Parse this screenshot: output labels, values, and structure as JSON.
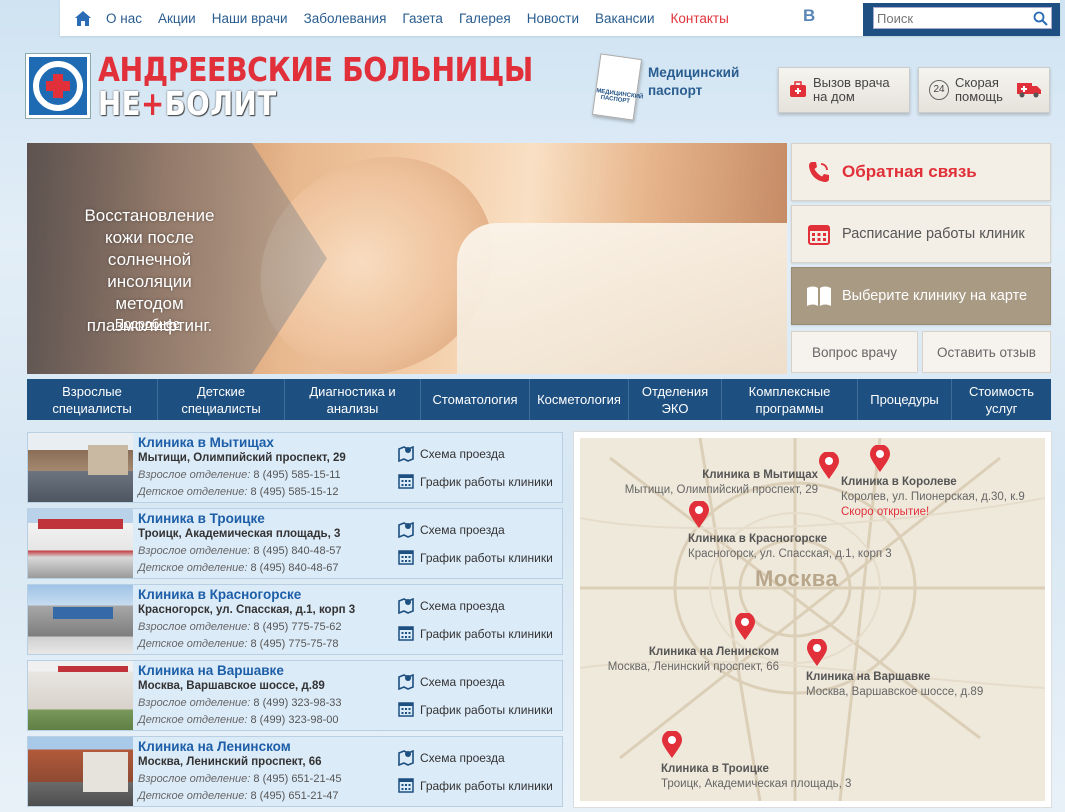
{
  "nav": {
    "items": [
      "О нас",
      "Акции",
      "Наши врачи",
      "Заболевания",
      "Газета",
      "Галерея",
      "Новости",
      "Вакансии",
      "Контакты"
    ],
    "vk": "B",
    "search_placeholder": "Поиск"
  },
  "logo": {
    "line1": "АНДРЕЕВСКИЕ БОЛЬНИЦЫ",
    "line2a": "НЕ",
    "line2plus": "+",
    "line2b": "БОЛИТ"
  },
  "passport": {
    "label": "Медицинский паспорт",
    "book_text": "МЕДИЦИНСКИЙ ПАСПОРТ"
  },
  "call_buttons": [
    {
      "label": "Вызов врача на дом",
      "icon": "medkit-icon"
    },
    {
      "label": "Скорая помощь",
      "badge": "24",
      "icon": "ambulance-icon"
    }
  ],
  "banner": {
    "text": "Восстановление кожи после солнечной инсоляции методом плазмолифтинг.",
    "more": "Подробнее"
  },
  "side": {
    "feedback": "Обратная связь",
    "schedule": "Расписание работы клиник",
    "map": "Выберите клинику на карте",
    "ask": "Вопрос врачу",
    "review": "Оставить отзыв"
  },
  "menu": [
    "Взрослые специалисты",
    "Детские специалисты",
    "Диагностика и анализы",
    "Стоматология",
    "Косметология",
    "Отделения ЭКО",
    "Комплексные программы",
    "Процедуры",
    "Стоимость услуг"
  ],
  "clinics": [
    {
      "name": "Клиника в Мытищах",
      "addr": "Мытищи, Олимпийский проспект, 29",
      "adult_label": "Взрослое отделение:",
      "adult": "8 (495) 585-15-11",
      "child_label": "Детское отделение:",
      "child": "8 (495) 585-15-12",
      "route": "Схема проезда",
      "hours": "График работы клиники"
    },
    {
      "name": "Клиника в Троицке",
      "addr": "Троицк, Академическая площадь, 3",
      "adult_label": "Взрослое отделение:",
      "adult": "8 (495) 840-48-57",
      "child_label": "Детское отделение:",
      "child": "8 (495) 840-48-67",
      "route": "Схема проезда",
      "hours": "График работы клиники"
    },
    {
      "name": "Клиника в Красногорске",
      "addr": "Красногорск, ул. Спасская, д.1, корп 3",
      "adult_label": "Взрослое отделение:",
      "adult": "8 (495) 775-75-62",
      "child_label": "Детское отделение:",
      "child": "8 (495) 775-75-78",
      "route": "Схема проезда",
      "hours": "График работы клиники"
    },
    {
      "name": "Клиника на Варшавке",
      "addr": "Москва, Варшавское шоссе, д.89",
      "adult_label": "Взрослое отделение:",
      "adult": "8 (499) 323-98-33",
      "child_label": "Детское отделение:",
      "child": "8 (499) 323-98-00",
      "route": "Схема проезда",
      "hours": "График работы клиники"
    },
    {
      "name": "Клиника на Ленинском",
      "addr": "Москва, Ленинский проспект, 66",
      "adult_label": "Взрослое отделение:",
      "adult": "8 (495) 651-21-45",
      "child_label": "Детское отделение:",
      "child": "8 (495) 651-21-47",
      "route": "Схема проезда",
      "hours": "График работы клиники"
    }
  ],
  "map": {
    "city": "Москва",
    "labels": [
      {
        "name": "Клиника в Мытищах",
        "addr": "Мытищи, Олимпийский проспект, 29"
      },
      {
        "name": "Клиника в Королеве",
        "addr": "Королев, ул. Пионерская, д.30, к.9",
        "note": "Скоро открытие!"
      },
      {
        "name": "Клиника в Красногорске",
        "addr": "Красногорск, ул. Спасская, д.1, корп 3"
      },
      {
        "name": "Клиника на Ленинском",
        "addr": "Москва, Ленинский проспект, 66"
      },
      {
        "name": "Клиника на Варшавке",
        "addr": "Москва, Варшавское шоссе, д.89"
      },
      {
        "name": "Клиника в Троицке",
        "addr": "Троицк, Академическая площадь, 3"
      }
    ]
  },
  "colors": {
    "brand_red": "#e13039",
    "brand_blue": "#1d4f80",
    "link_blue": "#1d5ea8"
  }
}
